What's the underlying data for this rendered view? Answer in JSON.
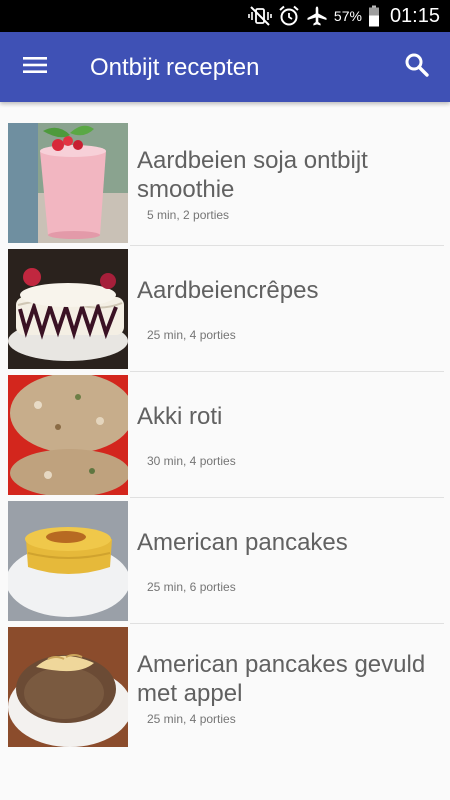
{
  "status_bar": {
    "battery_percent": "57%",
    "time": "01:15",
    "icons": [
      "mute-vibrate-icon",
      "alarm-icon",
      "airplane-mode-icon",
      "battery-icon"
    ]
  },
  "app_bar": {
    "title": "Ontbijt recepten",
    "color": "#3f51b5",
    "menu_icon": "hamburger-menu-icon",
    "search_icon": "search-icon"
  },
  "recipes": [
    {
      "title": "Aardbeien soja ontbijt smoothie",
      "meta": "5 min, 2 porties"
    },
    {
      "title": "Aardbeiencrêpes",
      "meta": "25 min, 4 porties"
    },
    {
      "title": "Akki roti",
      "meta": "30 min, 4 porties"
    },
    {
      "title": "American pancakes",
      "meta": "25 min, 6 porties"
    },
    {
      "title": "American pancakes gevuld met appel",
      "meta": "25 min, 4 porties"
    }
  ]
}
